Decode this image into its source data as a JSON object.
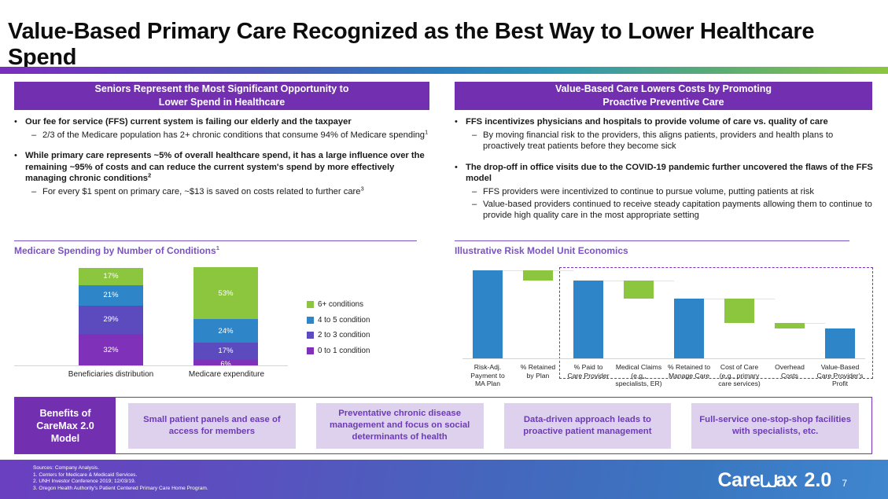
{
  "title": "Value-Based Primary Care Recognized as the Best Way to Lower Healthcare Spend",
  "panels": {
    "left": {
      "header": "Seniors Represent the Most Significant Opportunity to Lower Spend in Healthcare",
      "header_line1": "Seniors Represent the Most Significant Opportunity to",
      "header_line2": "Lower Spend in Healthcare",
      "bullets": [
        {
          "text": "Our fee for service (FFS) current system is failing our elderly and the taxpayer",
          "sub": [
            "2/3 of the Medicare population has 2+ chronic conditions that consume 94% of Medicare spending¹"
          ]
        },
        {
          "text": "While primary care represents ~5% of overall healthcare spend, it has a large influence over the remaining ~95% of costs and can reduce the current system's spend by more effectively managing chronic conditions²",
          "sub": [
            "For every $1 spent on primary care, ~$13 is saved on costs related to further care³"
          ]
        }
      ]
    },
    "right": {
      "header": "Value-Based Care Lowers Costs by Promoting Proactive Preventive Care",
      "header_line1": "Value-Based Care Lowers Costs by Promoting",
      "header_line2": "Proactive Preventive Care",
      "bullets": [
        {
          "text": "FFS incentivizes physicians and hospitals to provide volume of care vs. quality of care",
          "sub": [
            "By moving financial risk to the providers, this aligns patients, providers and health plans to proactively treat patients before they become sick"
          ]
        },
        {
          "text": "The drop-off in office visits due to the COVID-19 pandemic further uncovered the flaws of the FFS model",
          "sub": [
            "FFS providers were incentivized to continue to pursue volume, putting patients at risk",
            "Value-based providers continued to receive steady capitation payments allowing them to continue to provide high quality care in the most appropriate setting"
          ]
        }
      ]
    }
  },
  "sections": {
    "left_chart_title": "Medicare Spending by Number of Conditions¹",
    "right_chart_title": "Illustrative Risk Model Unit Economics"
  },
  "chart_data": [
    {
      "type": "bar",
      "stacked": true,
      "title": "Medicare Spending by Number of Conditions",
      "xlabel": "",
      "ylabel": "",
      "ylim": [
        0,
        100
      ],
      "grid": false,
      "legend_position": "right",
      "categories": [
        "Beneficiaries distribution",
        "Medicare expenditure"
      ],
      "series": [
        {
          "name": "6+ conditions",
          "color": "#8CC63F",
          "values": [
            17,
            53
          ],
          "labels": [
            "17%",
            "53%"
          ]
        },
        {
          "name": "4 to 5 condition",
          "color": "#2E86C8",
          "values": [
            21,
            24
          ],
          "labels": [
            "21%",
            "24%"
          ]
        },
        {
          "name": "2 to 3 condition",
          "color": "#5B4BBF",
          "values": [
            29,
            17
          ],
          "labels": [
            "29%",
            "17%"
          ]
        },
        {
          "name": "0 to 1 condition",
          "color": "#8031B9",
          "values": [
            32,
            6
          ],
          "labels": [
            "32%",
            "6%"
          ]
        }
      ]
    },
    {
      "type": "bar",
      "waterfall": true,
      "title": "Illustrative Risk Model Unit Economics",
      "xlabel": "",
      "ylabel": "",
      "ylim": [
        0,
        100
      ],
      "grid": false,
      "legend_position": "none",
      "annotation": "dashed box around last five steps",
      "categories": [
        "Risk-Adj. Payment to MA Plan",
        "% Retained by Plan",
        "% Paid to Care Provider",
        "Medical Claims (e.g., specialists, ER)",
        "% Retained to Manage Care",
        "Cost of Care (e.g., primary care services)",
        "Overhead Costs",
        "Value-Based Care Provider's Profit"
      ],
      "category_lines": [
        [
          "Risk-Adj.",
          "Payment to",
          "MA Plan"
        ],
        [
          "% Retained",
          "by Plan"
        ],
        [
          "% Paid to",
          "Care Provider"
        ],
        [
          "Medical Claims",
          "(e.g.,",
          "specialists, ER)"
        ],
        [
          "% Retained to",
          "Manage Care"
        ],
        [
          "Cost of Care",
          "(e.g., primary",
          "care services)"
        ],
        [
          "Overhead",
          "Costs"
        ],
        [
          "Value-Based",
          "Care Provider's",
          "Profit"
        ]
      ],
      "bars": [
        {
          "label": "Risk-Adj. Payment to MA Plan",
          "kind": "total",
          "color": "#2E86C8",
          "start": 0,
          "end": 100
        },
        {
          "label": "% Retained by Plan",
          "kind": "decrease",
          "color": "#8CC63F",
          "start": 88,
          "end": 100
        },
        {
          "label": "% Paid to Care Provider",
          "kind": "total",
          "color": "#2E86C8",
          "start": 0,
          "end": 88
        },
        {
          "label": "Medical Claims (e.g., specialists, ER)",
          "kind": "decrease",
          "color": "#8CC63F",
          "start": 68,
          "end": 88
        },
        {
          "label": "% Retained to Manage Care",
          "kind": "total",
          "color": "#2E86C8",
          "start": 0,
          "end": 68
        },
        {
          "label": "Cost of Care (e.g., primary care services)",
          "kind": "decrease",
          "color": "#8CC63F",
          "start": 40,
          "end": 68
        },
        {
          "label": "Overhead Costs",
          "kind": "decrease",
          "color": "#8CC63F",
          "start": 34,
          "end": 40
        },
        {
          "label": "Value-Based Care Provider's Profit",
          "kind": "total",
          "color": "#2E86C8",
          "start": 0,
          "end": 34
        }
      ]
    }
  ],
  "benefits": {
    "lead": "Benefits of CareMax 2.0 Model",
    "lead_lines": [
      "Benefits of",
      "CareMax 2.0",
      "Model"
    ],
    "items": [
      "Small patient panels and ease of access for members",
      "Preventative chronic disease management and focus on social determinants of health",
      "Data-driven approach leads to proactive patient management",
      "Full-service one-stop-shop facilities with specialists, etc."
    ]
  },
  "footer": {
    "sources": [
      "Sources: Company Analysis.",
      "1. Centers for Medicare & Medicaid Services.",
      "2. UNH Investor Conference 2019; 12/03/19.",
      "3. Oregon Health Authority’s Patient Centered Primary Care Home Program."
    ],
    "logo_pre": "Care",
    "logo_post": "ax",
    "logo_version": "2.0",
    "page_number": "7"
  },
  "colors": {
    "purple": "#7230b0",
    "accent_purple": "#7b2fbe",
    "green": "#8CC63F",
    "blue": "#2E86C8",
    "indigo": "#5B4BBF",
    "violet": "#8031B9",
    "card_bg": "#ddd1ed",
    "card_text": "#6d3bb5"
  }
}
